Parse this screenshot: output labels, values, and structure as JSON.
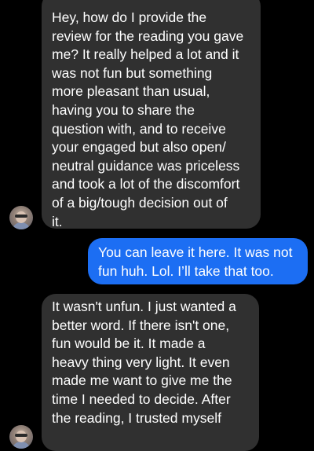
{
  "conversation": {
    "messages": [
      {
        "sender": "other",
        "lines": [
          "Hey, how do I provide the",
          "review for the reading you gave",
          "me? It really helped a lot and it",
          "was not fun but something",
          "more pleasant than usual,",
          "having you to share the",
          "question with, and to receive",
          "your engaged but also open/",
          "neutral guidance was priceless",
          "and took a lot of the discomfort",
          "of a big/tough decision out of",
          "it."
        ]
      },
      {
        "sender": "me",
        "lines": [
          "You can leave it here. It was not",
          "fun huh. Lol. I’ll take that too."
        ]
      },
      {
        "sender": "other",
        "lines": [
          "It wasn't unfun. I just wanted a",
          "better word. If there isn't one,",
          "fun would be it. It made a",
          "heavy thing very light. It even",
          "made me want to give me the",
          "time I needed to decide. After",
          "the reading, I trusted myself"
        ]
      }
    ]
  },
  "colors": {
    "background": "#000000",
    "incoming_bubble": "#303030",
    "outgoing_bubble": "#1c6ef3",
    "text": "#ffffff"
  }
}
